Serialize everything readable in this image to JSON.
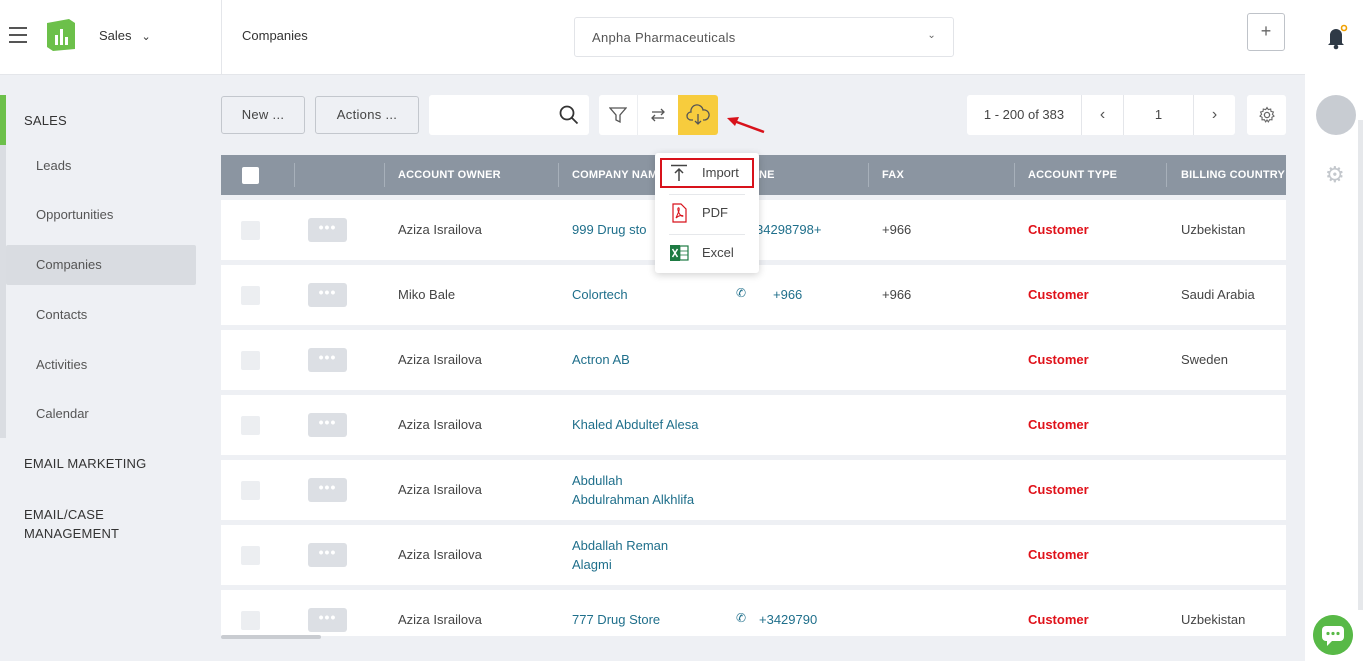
{
  "topbar": {
    "app_name": "Sales",
    "breadcrumb": "Companies",
    "company_selected": "Anpha Pharmaceuticals",
    "add_label": "+"
  },
  "sidebar": {
    "sections": [
      {
        "label": "SALES"
      },
      {
        "label": "EMAIL MARKETING"
      },
      {
        "label": "EMAIL/CASE"
      },
      {
        "label": "MANAGEMENT"
      }
    ],
    "items": [
      {
        "label": "Leads"
      },
      {
        "label": "Opportunities"
      },
      {
        "label": "Companies",
        "active": true
      },
      {
        "label": "Contacts"
      },
      {
        "label": "Activities"
      },
      {
        "label": "Calendar"
      }
    ]
  },
  "toolbar": {
    "new_label": "New ...",
    "actions_label": "Actions ...",
    "search_placeholder": "",
    "pager_count": "1 - 200 of 383",
    "page_number": "1",
    "prev": "‹",
    "next": "›"
  },
  "export_menu": {
    "items": [
      "Import",
      "PDF",
      "Excel"
    ],
    "highlighted": "Import"
  },
  "table": {
    "headers": [
      "ACCOUNT OWNER",
      "COMPANY NAME",
      "PHONE",
      "FAX",
      "ACCOUNT TYPE",
      "BILLING COUNTRY"
    ],
    "header_visible": [
      "ACCOUNT OWNER",
      "COMPANY NAM",
      "NE",
      "FAX",
      "ACCOUNT TYPE",
      "BILLING COUNTRY"
    ],
    "rows": [
      {
        "owner": "Aziza Israilova",
        "company": "999 Drug sto",
        "company2": "",
        "phone": "+34298798",
        "fax": "+966",
        "type": "Customer",
        "country": "Uzbekistan"
      },
      {
        "owner": "Miko Bale",
        "company": "Colortech",
        "company2": "",
        "phone": "+966",
        "fax": "+966",
        "type": "Customer",
        "country": "Saudi Arabia"
      },
      {
        "owner": "Aziza Israilova",
        "company": "Actron AB",
        "company2": "",
        "phone": "",
        "fax": "",
        "type": "Customer",
        "country": "Sweden"
      },
      {
        "owner": "Aziza Israilova",
        "company": "Khaled Abdultef Alesa",
        "company2": "",
        "phone": "",
        "fax": "",
        "type": "Customer",
        "country": ""
      },
      {
        "owner": "Aziza Israilova",
        "company": "Abdullah",
        "company2": "Abdulrahman Alkhlifa",
        "phone": "",
        "fax": "",
        "type": "Customer",
        "country": ""
      },
      {
        "owner": "Aziza Israilova",
        "company": "Abdallah Reman",
        "company2": "Alagmi",
        "phone": "",
        "fax": "",
        "type": "Customer",
        "country": ""
      },
      {
        "owner": "Aziza Israilova",
        "company": "777 Drug Store",
        "company2": "",
        "phone": "+3429790",
        "fax": "",
        "type": "Customer",
        "country": "Uzbekistan"
      }
    ],
    "row_menu_glyph": "•••"
  },
  "colors": {
    "brand_green": "#6cc04a",
    "header_gray": "#8b95a1",
    "accent_yellow": "#f7cc3d",
    "customer_red": "#e0121a",
    "link_teal": "#1f6f8b"
  },
  "icons": [
    "hamburger-icon",
    "app-logo-icon",
    "chevron-down-icon",
    "bell-icon",
    "search-icon",
    "filter-icon",
    "swap-icon",
    "cloud-download-icon",
    "gear-icon",
    "upload-icon",
    "pdf-icon",
    "excel-icon",
    "phone-icon",
    "chat-icon"
  ]
}
